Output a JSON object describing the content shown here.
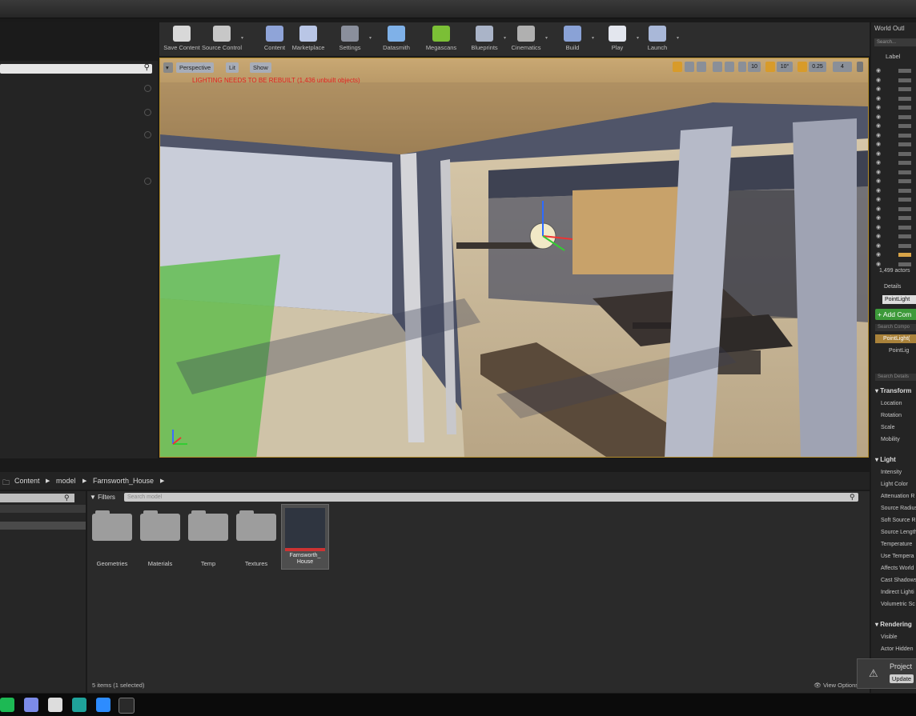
{
  "toolbar": {
    "buttons": [
      {
        "label": "Save Content",
        "icon": "save-icon",
        "color": "#d8d8d8"
      },
      {
        "label": "Source Control",
        "icon": "source-control-icon",
        "color": "#c7c7c7"
      },
      {
        "label": "Content",
        "icon": "content-icon",
        "color": "#8fa4d8"
      },
      {
        "label": "Marketplace",
        "icon": "marketplace-icon",
        "color": "#b9c6e6"
      },
      {
        "label": "Settings",
        "icon": "settings-icon",
        "color": "#8a8f9c"
      },
      {
        "label": "Datasmith",
        "icon": "datasmith-icon",
        "color": "#7fb1e8"
      },
      {
        "label": "Megascans",
        "icon": "megascans-icon",
        "color": "#7bbf36"
      },
      {
        "label": "Blueprints",
        "icon": "blueprints-icon",
        "color": "#aab4c8"
      },
      {
        "label": "Cinematics",
        "icon": "cinematics-icon",
        "color": "#b0b0b0"
      },
      {
        "label": "Build",
        "icon": "build-icon",
        "color": "#8aa2d6"
      },
      {
        "label": "Play",
        "icon": "play-icon",
        "color": "#e3e6ee"
      },
      {
        "label": "Launch",
        "icon": "launch-icon",
        "color": "#a9b8d8"
      }
    ]
  },
  "viewport": {
    "perspective_label": "Perspective",
    "lit_label": "Lit",
    "show_label": "Show",
    "warning": "LIGHTING NEEDS TO BE REBUILT (1,436 unbuilt objects)",
    "rotation_snap": "10°",
    "scale_snap": "0.25",
    "grid_snap": "10",
    "camera_speed": "4"
  },
  "world_outliner": {
    "title": "World Outl",
    "search_placeholder": "Search...",
    "column_label": "Label",
    "actor_count": "1,499 actors"
  },
  "details": {
    "title": "Details",
    "selected_name": "PointLight",
    "add_component": "+ Add Com",
    "search_components": "Search Compo",
    "component_root": "PointLight(",
    "component_child": "PointLig",
    "search_details": "Search Details",
    "sections": {
      "transform": "Transform",
      "light": "Light",
      "rendering": "Rendering"
    },
    "transform_rows": [
      "Location",
      "Rotation",
      "Scale",
      "Mobility"
    ],
    "light_rows": [
      "Intensity",
      "Light Color",
      "Attenuation R",
      "Source Radius",
      "Soft Source R",
      "Source Length",
      "Temperature",
      "Use Tempera",
      "Affects World",
      "Cast Shadows",
      "Indirect Lighti",
      "Volumetric Sc"
    ],
    "rendering_rows": [
      "Visible",
      "Actor Hidden"
    ]
  },
  "content_browser": {
    "breadcrumb": [
      "Content",
      "model",
      "Farnsworth_House"
    ],
    "filters_label": "Filters",
    "search_placeholder": "Search model",
    "folders": [
      "Geometries",
      "Materials",
      "Temp",
      "Textures"
    ],
    "asset": "Farnsworth_ House",
    "status": "5 items (1 selected)",
    "view_options": "View Options"
  },
  "notification": {
    "text": "Project",
    "button": "Update"
  },
  "taskbar": {
    "icons": [
      {
        "name": "spotify-icon",
        "color": "#1db954"
      },
      {
        "name": "discord-icon",
        "color": "#7c8be8"
      },
      {
        "name": "obs-icon",
        "color": "#dddddd"
      },
      {
        "name": "3dsmax-icon",
        "color": "#1fa39b"
      },
      {
        "name": "zoom-icon",
        "color": "#2d8cff"
      },
      {
        "name": "unreal-icon",
        "color": "#2a2a2a"
      }
    ]
  }
}
